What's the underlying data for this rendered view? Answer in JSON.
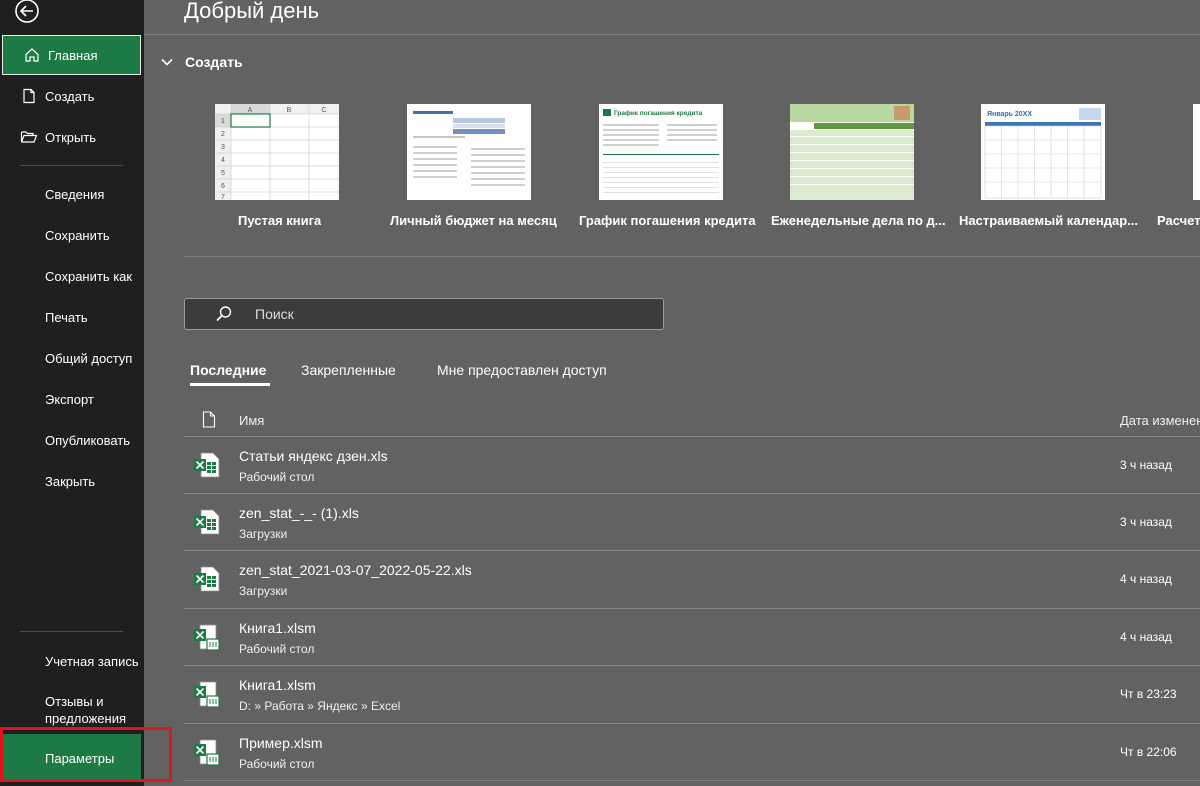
{
  "sidebar": {
    "items": [
      {
        "label": "Главная",
        "icon": "home-icon",
        "active": true
      },
      {
        "label": "Создать",
        "icon": "new-file-icon"
      },
      {
        "label": "Открыть",
        "icon": "open-folder-icon"
      },
      {
        "label": "Сведения"
      },
      {
        "label": "Сохранить"
      },
      {
        "label": "Сохранить как"
      },
      {
        "label": "Печать"
      },
      {
        "label": "Общий доступ"
      },
      {
        "label": "Экспорт"
      },
      {
        "label": "Опубликовать"
      },
      {
        "label": "Закрыть"
      }
    ],
    "account": "Учетная запись",
    "feedback": "Отзывы и предложения",
    "options": "Параметры"
  },
  "header": {
    "greeting": "Добрый день"
  },
  "create": {
    "title": "Создать",
    "templates": [
      {
        "label": "Пустая книга"
      },
      {
        "label": "Личный бюджет на месяц"
      },
      {
        "label": "График погашения кредита"
      },
      {
        "label": "Еженедельные дела по д..."
      },
      {
        "label": "Настраиваемый календар..."
      },
      {
        "label": "Расчет"
      }
    ],
    "blank_sheet": {
      "cols": [
        "A",
        "B",
        "C"
      ],
      "rows": [
        "1",
        "2",
        "3",
        "4",
        "5",
        "6",
        "7"
      ]
    },
    "loan_title": "График погашения кредита",
    "calendar_title": "Январь 20XX"
  },
  "search": {
    "placeholder": "Поиск"
  },
  "tabs": [
    {
      "label": "Последние",
      "active": true
    },
    {
      "label": "Закрепленные"
    },
    {
      "label": "Мне предоставлен доступ"
    }
  ],
  "files": {
    "col_name": "Имя",
    "col_date": "Дата изменения",
    "rows": [
      {
        "name": "Статьи яндекс дзен.xls",
        "location": "Рабочий стол",
        "date": "3 ч назад",
        "type": "xls"
      },
      {
        "name": "zen_stat_-_- (1).xls",
        "location": "Загрузки",
        "date": "3 ч назад",
        "type": "xls"
      },
      {
        "name": "zen_stat_2021-03-07_2022-05-22.xls",
        "location": "Загрузки",
        "date": "4 ч назад",
        "type": "xls"
      },
      {
        "name": "Книга1.xlsm",
        "location": "Рабочий стол",
        "date": "4 ч назад",
        "type": "xlsm"
      },
      {
        "name": "Книга1.xlsm",
        "location": "D: » Работа » Яндекс » Excel",
        "date": "Чт в 23:23",
        "type": "xlsm"
      },
      {
        "name": "Пример.xlsm",
        "location": "Рабочий стол",
        "date": "Чт в 22:06",
        "type": "xlsm"
      }
    ]
  },
  "colors": {
    "accent": "#1e7a45",
    "sidebar": "#1f1f1f",
    "main": "#626262",
    "highlight": "#e0141c"
  }
}
